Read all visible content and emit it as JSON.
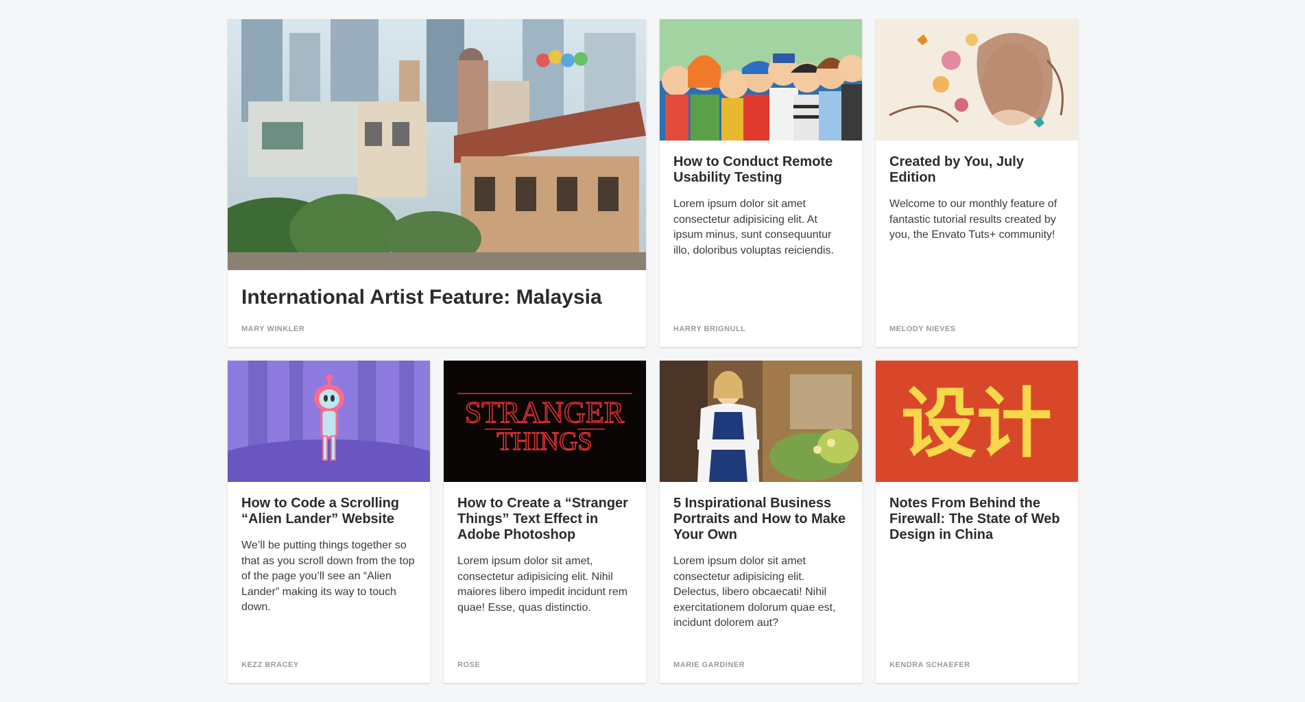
{
  "cards": [
    {
      "title": "International Artist Feature: Malaysia",
      "excerpt": "",
      "author": "MARY WINKLER",
      "image": "malaysia-street-illustration"
    },
    {
      "title": "How to Conduct Remote Usability Testing",
      "excerpt": "Lorem ipsum dolor sit amet consectetur adipisicing elit. At ipsum minus, sunt consequuntur illo, doloribus voluptas reiciendis.",
      "author": "HARRY BRIGNULL",
      "image": "cartoon-people-illustration"
    },
    {
      "title": "Created by You, July Edition",
      "excerpt": "Welcome to our monthly feature of fantastic tutorial results created by you, the Envato Tuts+ community!",
      "author": "MELODY NIEVES",
      "image": "floral-portrait-illustration"
    },
    {
      "title": "How to Code a Scrolling “Alien Lander” Website",
      "excerpt": "We’ll be putting things together so that as you scroll down from the top of the page you’ll see an “Alien Lander” making its way to touch down.",
      "author": "KEZZ BRACEY",
      "image": "alien-forest-illustration"
    },
    {
      "title": "How to Create a “Stranger Things” Text Effect in Adobe Photoshop",
      "excerpt": "Lorem ipsum dolor sit amet, consectetur adipisicing elit. Nihil maiores libero impedit incidunt rem quae! Esse, quas distinctio.",
      "author": "ROSE",
      "image": "stranger-things-title",
      "image_text_line1": "STRANGER",
      "image_text_line2": "THINGS"
    },
    {
      "title": "5 Inspirational Business Portraits and How to Make Your Own",
      "excerpt": "Lorem ipsum dolor sit amet consectetur adipisicing elit. Delectus, libero obcaecati! Nihil exercitationem dolorum quae est, incidunt dolorem aut?",
      "author": "MARIE GARDINER",
      "image": "florist-portrait-photo"
    },
    {
      "title": "Notes From Behind the Firewall: The State of Web Design in China",
      "excerpt": "",
      "author": "KENDRA SCHAEFER",
      "image": "chinese-characters-design",
      "image_text": "设计"
    }
  ],
  "colors": {
    "background": "#f5f6f8",
    "card": "#ffffff",
    "title": "#2b2b2b",
    "author": "#9a9a9a"
  }
}
